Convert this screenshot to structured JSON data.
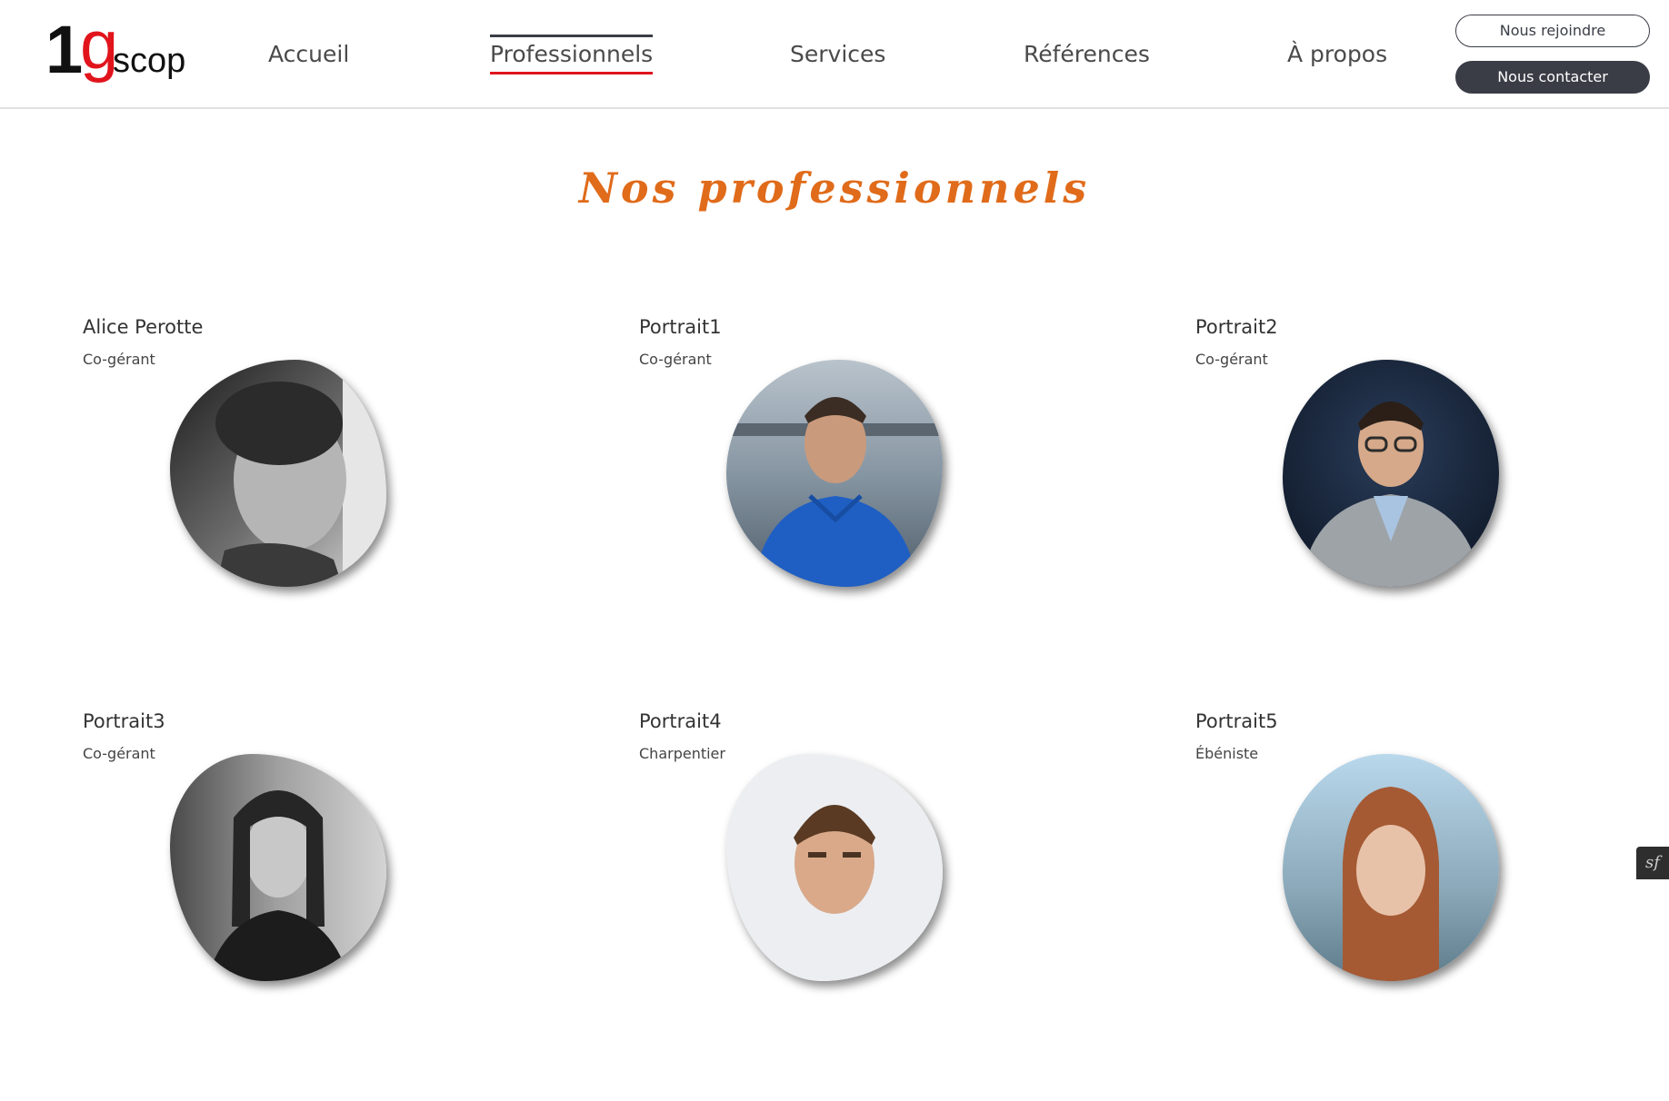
{
  "header": {
    "logo": {
      "one": "1",
      "g": "g",
      "scop": "scop"
    },
    "nav": [
      {
        "label": "Accueil"
      },
      {
        "label": "Professionnels"
      },
      {
        "label": "Services"
      },
      {
        "label": "Références"
      },
      {
        "label": "À propos"
      }
    ],
    "active_nav": "Professionnels",
    "join_label": "Nous rejoindre",
    "contact_label": "Nous contacter"
  },
  "colors": {
    "accent_orange": "#e06b1a",
    "brand_red": "#e1141c",
    "dark_button": "#3a3d46"
  },
  "main": {
    "title": "Nos professionnels",
    "professionals": [
      {
        "name": "Alice Perotte",
        "role": "Co-gérant"
      },
      {
        "name": "Portrait1",
        "role": "Co-gérant"
      },
      {
        "name": "Portrait2",
        "role": "Co-gérant"
      },
      {
        "name": "Portrait3",
        "role": "Co-gérant"
      },
      {
        "name": "Portrait4",
        "role": "Charpentier"
      },
      {
        "name": "Portrait5",
        "role": "Ébéniste"
      }
    ]
  },
  "debug_toolbar": {
    "icon": "symfony-icon",
    "label": "sf"
  }
}
